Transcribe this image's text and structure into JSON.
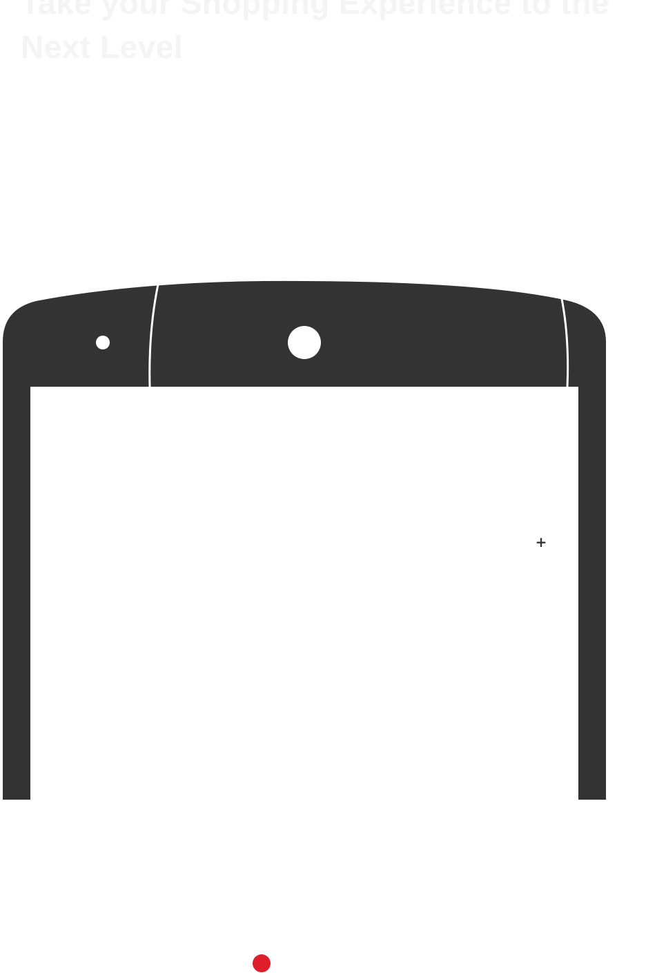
{
  "hero": {
    "heading": "Take your Shopping Experience to the Next Level",
    "heading_color": "#f4f4f4"
  },
  "phone": {
    "frame_color": "#333333",
    "screen_color": "#ffffff",
    "add_marker": "+"
  },
  "carousel": {
    "active_dot_color": "#e01e2b"
  }
}
